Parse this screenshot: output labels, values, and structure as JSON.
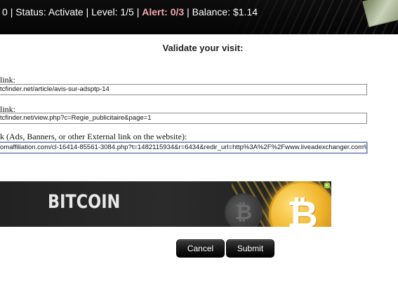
{
  "topbar": {
    "prefix": "0",
    "status_text": "| Status: Activate | Level: 1/5 |",
    "alert_text": "Alert: 0/3",
    "balance_text": "| Balance: $1.14"
  },
  "form": {
    "heading": "Validate your visit:",
    "fields": [
      {
        "label": "link:",
        "value": "tcfinder.net/article/avis-sur-adsptp-14"
      },
      {
        "label": "link:",
        "value": "tcfinder.net/view.php?c=Regie_publicitaire&page=1"
      },
      {
        "label": "k (Ads, Banners, or other External link on the website):",
        "value": "omaffiliation.com/cl-16414-85561-3084.php?t=1482115934&r=6434&redir_url=http%3A%2F%2Fwww.liveadexchanger.com%"
      }
    ]
  },
  "banner": {
    "text": "BITCOIN",
    "coin_symbol": "₿"
  },
  "buttons": {
    "cancel": "Cancel",
    "submit": "Submit"
  },
  "colors": {
    "alert": "#f2a7b0",
    "topbar_bg": "#0d0d0d",
    "button_bg": "#111111",
    "coin_gold": "#f0b52c"
  }
}
